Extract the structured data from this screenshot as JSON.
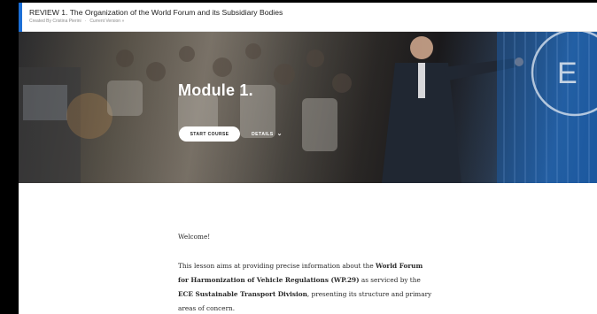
{
  "header": {
    "course_title": "REVIEW 1. The Organization of the World Forum and its Subsidiary Bodies",
    "created_by": "Created By Cristina Pierini",
    "current_version": "Current Version »"
  },
  "hero": {
    "module_title": "Module 1.",
    "start_button": "START COURSE",
    "details_label": "DETAILS",
    "details_icon": "chevron-down-icon"
  },
  "content": {
    "welcome": "Welcome!",
    "paragraph": {
      "p1": "This lesson aims at providing precise information about the ",
      "b1": "World Forum for Harmonization of Vehicle Regulations (WP.29)",
      "p2": " as serviced by the ",
      "b2": "ECE Sustainable Transport Division",
      "p3": ", presenting its structure and primary areas of concern."
    }
  },
  "colors": {
    "accent": "#1c6fd6",
    "page_bg": "#ffffff",
    "frame": "#000000"
  }
}
